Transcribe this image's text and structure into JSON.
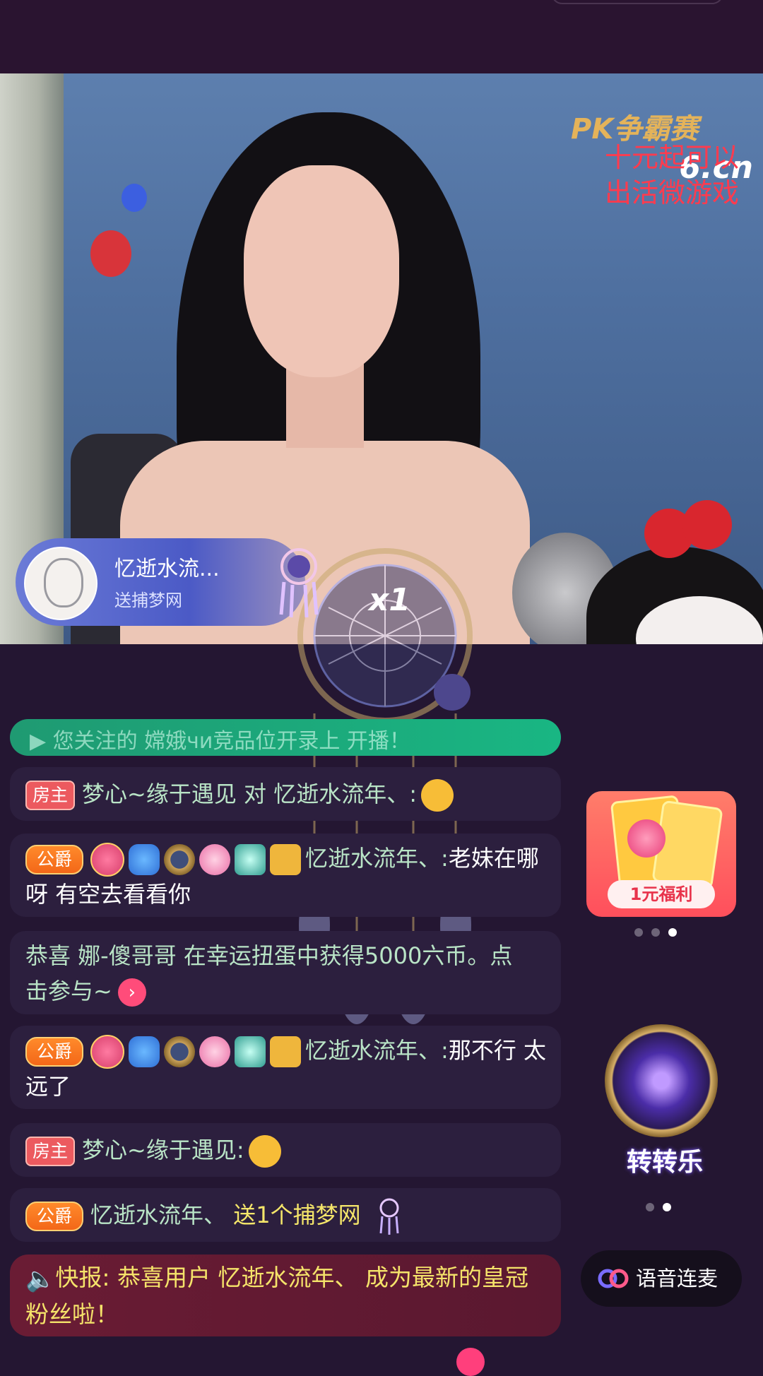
{
  "stream": {
    "watermark": "6.cn",
    "pk_title": "PK争霸赛",
    "promo_line1": "十元起可以",
    "promo_line2": "出活微游戏"
  },
  "gift_banner": {
    "user_name": "忆逝水流...",
    "action": "送捕梦网",
    "count": "x1",
    "icon": "dreamcatcher-icon"
  },
  "chat": {
    "faded_text": "▶ 您关注的 嫦娥чи竞品位开录上 开播！",
    "messages": [
      {
        "badge": "房主",
        "user": "梦心~缘于遇见",
        "text": " 对 忆逝水流年、:",
        "emoji": "hand-over-mouth-emoji"
      },
      {
        "badge": "公爵",
        "user": "忆逝水流年、:",
        "text": "老妹在哪呀  有空去看看你"
      },
      {
        "text_a": "恭喜 娜-傻哥哥 在幸运扭蛋中获得5000六币。点击参与~",
        "arrow": "›"
      },
      {
        "badge": "公爵",
        "user": "忆逝水流年、:",
        "text": "那不行  太远了"
      },
      {
        "badge": "房主",
        "user": "梦心~缘于遇见:",
        "text": "",
        "emoji": "pleading-emoji"
      },
      {
        "badge": "公爵",
        "user": "忆逝水流年、",
        "text": " 送1个捕梦网"
      }
    ],
    "news_label": "快报:",
    "news_text": " 恭喜用户 忆逝水流年、 成为最新的皇冠粉丝啦！"
  },
  "side": {
    "welfare_label": "1元福利",
    "wheel_label": "转转乐",
    "voice_label": "语音连麦"
  },
  "colors": {
    "background": "#241632",
    "host_badge": "#ec5a5f",
    "duke_badge": "#f36718",
    "username": "#b9e4c6",
    "highlight": "#f5e66a"
  }
}
